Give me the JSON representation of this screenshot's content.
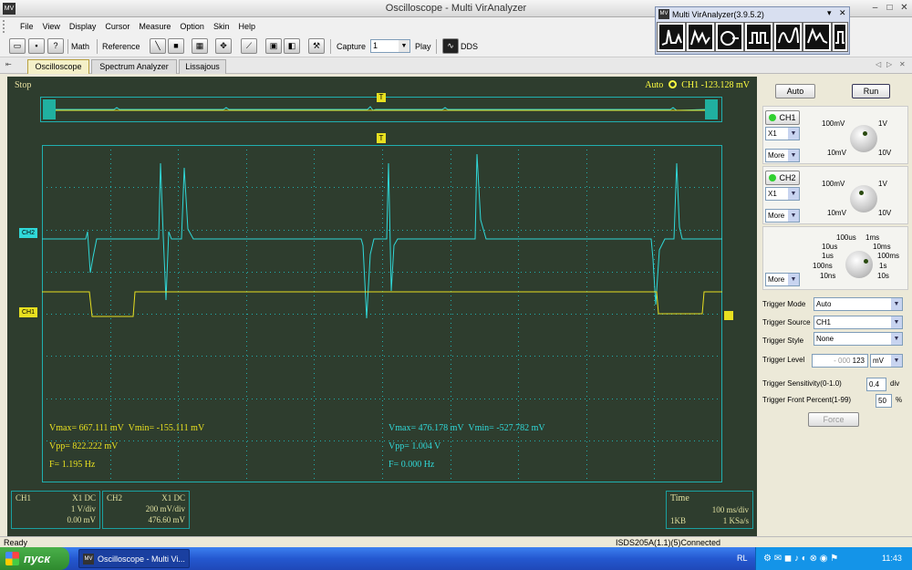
{
  "window": {
    "title": "Oscilloscope - Multi VirAnalyzer"
  },
  "menu": [
    "File",
    "View",
    "Display",
    "Cursor",
    "Measure",
    "Option",
    "Skin",
    "Help"
  ],
  "toolbar": {
    "math": "Math",
    "reference": "Reference",
    "capture_label": "Capture",
    "capture_value": "1",
    "play": "Play",
    "dds": "DDS"
  },
  "floating": {
    "title": "Multi VirAnalyzer(3.9.5.2)"
  },
  "tabs": [
    "Oscilloscope",
    "Spectrum Analyzer",
    "Lissajous"
  ],
  "scope": {
    "state": "Stop",
    "trigger_status": "Auto",
    "trigger_readout": "CH1 -123.128 mV",
    "trigger_marker": "T",
    "ch2_marker": "CH2",
    "ch1_marker": "CH1",
    "colors": {
      "background": "#2e3d2e",
      "ch1": "#e8e020",
      "ch2": "#30d8d8",
      "grid": "#20b0b0"
    },
    "meas_ch1": {
      "vmax": "Vmax= 667.111 mV",
      "vmin": "Vmin= -155.111 mV",
      "vpp": "Vpp= 822.222 mV",
      "f": "F= 1.195 Hz"
    },
    "meas_ch2": {
      "vmax": "Vmax= 476.178 mV",
      "vmin": "Vmin= -527.782 mV",
      "vpp": "Vpp= 1.004 V",
      "f": "F= 0.000 Hz"
    },
    "ch1_box": {
      "name": "CH1",
      "mode": "X1  DC",
      "vdiv": "1 V/div",
      "offset": "0.00 mV"
    },
    "ch2_box": {
      "name": "CH2",
      "mode": "X1  DC",
      "vdiv": "200 mV/div",
      "offset": "476.60 mV"
    },
    "time_box": {
      "title": "Time",
      "tdiv": "100 ms/div",
      "depth": "1KB",
      "rate": "1 KSa/s"
    }
  },
  "right": {
    "auto": "Auto",
    "run": "Run",
    "ch1": {
      "label": "CH1",
      "probe": "X1",
      "more": "More",
      "k_tl": "100mV",
      "k_tr": "1V",
      "k_bl": "10mV",
      "k_br": "10V"
    },
    "ch2": {
      "label": "CH2",
      "probe": "X1",
      "more": "More",
      "k_tl": "100mV",
      "k_tr": "1V",
      "k_bl": "10mV",
      "k_br": "10V"
    },
    "time": {
      "more": "More",
      "l1": "100us",
      "l2": "1ms",
      "l3": "10us",
      "l4": "10ms",
      "l5": "1us",
      "l6": "100ms",
      "l7": "100ns",
      "l8": "1s",
      "l9": "10ns",
      "l10": "10s"
    },
    "trigger": {
      "mode_label": "Trigger Mode",
      "mode": "Auto",
      "source_label": "Trigger Source",
      "source": "CH1",
      "style_label": "Trigger Style",
      "style": "None",
      "level_label": "Trigger Level",
      "level_prefix": "- 000",
      "level_value": "123",
      "level_unit": "mV",
      "sens_label": "Trigger Sensitivity(0-1.0)",
      "sens": "0.4",
      "sens_unit": "div",
      "front_label": "Trigger Front Percent(1-99)",
      "front": "50",
      "front_unit": "%",
      "force": "Force"
    }
  },
  "status": {
    "left": "Ready",
    "right": "ISDS205A(1.1)(5)Connected"
  },
  "taskbar": {
    "start": "пуск",
    "item": "Oscilloscope - Multi Vi...",
    "lang": "RL",
    "time": "11:43"
  }
}
